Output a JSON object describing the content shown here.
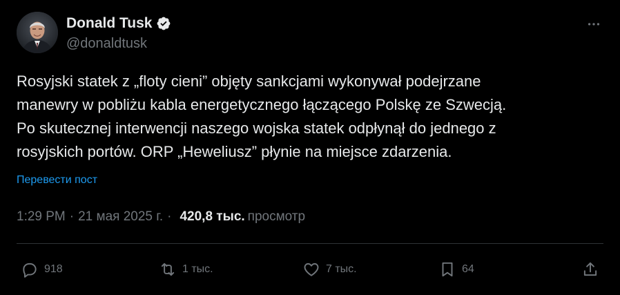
{
  "author": {
    "display_name": "Donald Tusk",
    "handle": "@donaldtusk",
    "verified_icon": "verified-badge-icon"
  },
  "more_icon": "more-options-icon",
  "post": {
    "text": "Rosyjski statek z „floty cieni” objęty sankcjami wykonywał podejrzane\nmanewry w pobliżu kabla energetycznego łączącego Polskę ze Szwecją.\nPo skutecznej interwencji naszego wojska statek odpłynął do jednego z\nrosyjskich portów. ORP „Heweliusz” płynie na miejsce zdarzenia.",
    "translate_label": "Перевести пост"
  },
  "meta": {
    "time": "1:29 PM",
    "dot1": "·",
    "date": "21 мая 2025 г.",
    "dot2": "·",
    "views_count": "420,8 тыс.",
    "views_label": "просмотр"
  },
  "actions": {
    "replies": "918",
    "reposts": "1 тыс.",
    "likes": "7 тыс.",
    "bookmarks": "64"
  },
  "colors": {
    "background": "#000000",
    "text": "#e7e9ea",
    "muted": "#71767b",
    "accent": "#1d9bf0",
    "divider": "#2f3336"
  }
}
